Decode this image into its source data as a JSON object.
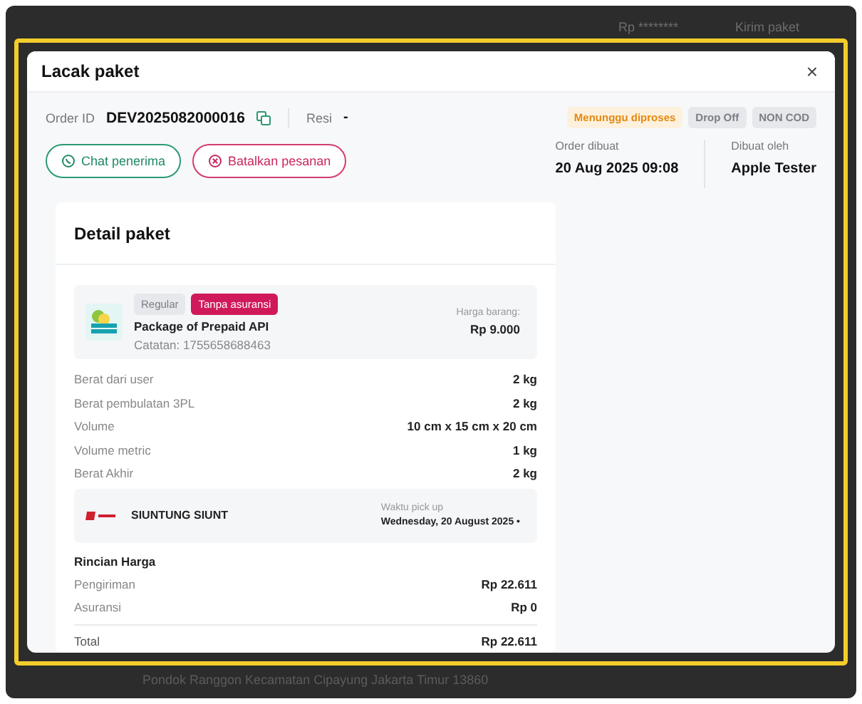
{
  "background": {
    "balance": "Rp ********",
    "send_link": "Kirim paket",
    "address_line": "Pondok Ranggon Kecamatan Cipayung Jakarta Timur 13860"
  },
  "modal": {
    "title": "Lacak paket",
    "close": "×"
  },
  "order": {
    "id_label": "Order ID",
    "id": "DEV2025082000016",
    "resi_label": "Resi",
    "resi": "-"
  },
  "badges": [
    {
      "label": "Menunggu diproses",
      "kind": "status"
    },
    {
      "label": "Drop Off",
      "kind": "neutral"
    },
    {
      "label": "NON COD",
      "kind": "neutral"
    }
  ],
  "actions": [
    {
      "label": "Chat penerima",
      "kind": "chat"
    },
    {
      "label": "Batalkan pesanan",
      "kind": "cancel"
    }
  ],
  "meta": [
    {
      "label": "Order dibuat",
      "value": "20 Aug 2025 09:08"
    },
    {
      "label": "Dibuat oleh",
      "value": "Apple Tester"
    }
  ],
  "detail": {
    "title": "Detail paket",
    "item": {
      "tags": [
        {
          "label": "Regular",
          "kind": "neutral"
        },
        {
          "label": "Tanpa asuransi",
          "kind": "danger"
        }
      ],
      "name": "Package of Prepaid API",
      "note": "Catatan: 1755658688463",
      "price_label": "Harga barang:",
      "price": "Rp 9.000"
    },
    "specs": [
      {
        "label": "Berat dari user",
        "value": "2 kg"
      },
      {
        "label": "Berat pembulatan 3PL",
        "value": "2 kg"
      },
      {
        "label": "Volume",
        "value": "10 cm x 15 cm x 20 cm"
      },
      {
        "label": "Volume metric",
        "value": "1 kg"
      },
      {
        "label": "Berat Akhir",
        "value": "2 kg"
      }
    ],
    "courier": {
      "name": "SIUNTUNG SIUNT",
      "pickup_label": "Waktu pick up",
      "pickup": "Wednesday, 20 August 2025 •"
    },
    "price_title": "Rincian Harga",
    "prices": [
      {
        "label": "Pengiriman",
        "value": "Rp 22.611"
      },
      {
        "label": "Asuransi",
        "value": "Rp 0"
      }
    ],
    "total": {
      "label": "Total",
      "value": "Rp 22.611"
    }
  }
}
